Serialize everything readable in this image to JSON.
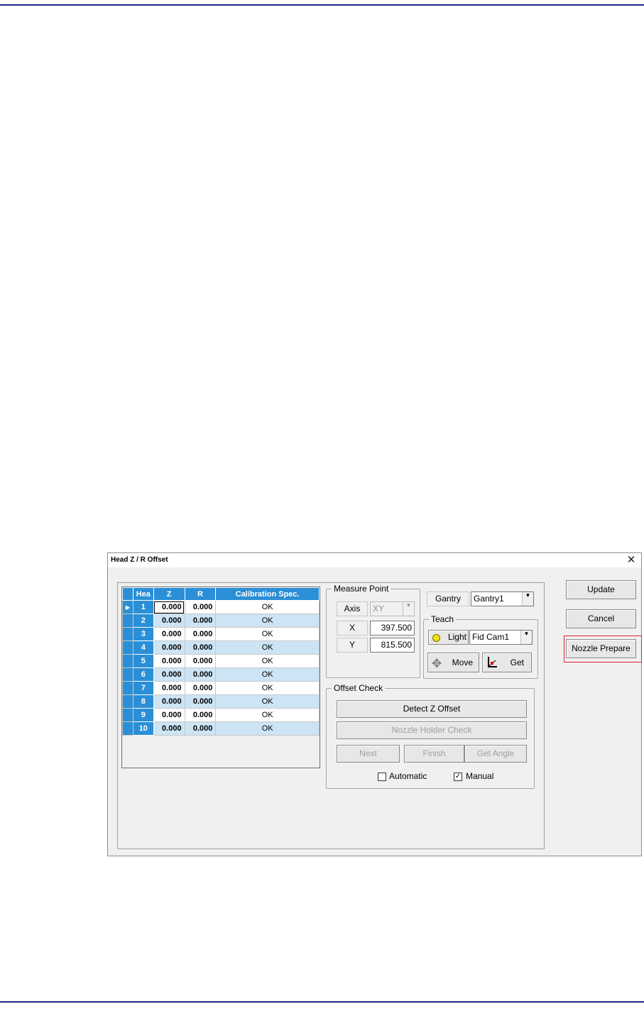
{
  "window": {
    "title": "Head Z / R Offset",
    "close_symbol": "✕"
  },
  "grid": {
    "columns": [
      "Hea",
      "Z",
      "R",
      "Calibration Spec."
    ],
    "row_marker": "▶",
    "rows": [
      {
        "head": "1",
        "z": "0.000",
        "r": "0.000",
        "spec": "OK"
      },
      {
        "head": "2",
        "z": "0.000",
        "r": "0.000",
        "spec": "OK"
      },
      {
        "head": "3",
        "z": "0.000",
        "r": "0.000",
        "spec": "OK"
      },
      {
        "head": "4",
        "z": "0.000",
        "r": "0.000",
        "spec": "OK"
      },
      {
        "head": "5",
        "z": "0.000",
        "r": "0.000",
        "spec": "OK"
      },
      {
        "head": "6",
        "z": "0.000",
        "r": "0.000",
        "spec": "OK"
      },
      {
        "head": "7",
        "z": "0.000",
        "r": "0.000",
        "spec": "OK"
      },
      {
        "head": "8",
        "z": "0.000",
        "r": "0.000",
        "spec": "OK"
      },
      {
        "head": "9",
        "z": "0.000",
        "r": "0.000",
        "spec": "OK"
      },
      {
        "head": "10",
        "z": "0.000",
        "r": "0.000",
        "spec": "OK"
      }
    ]
  },
  "measure_point": {
    "legend": "Measure Point",
    "axis_label": "Axis",
    "axis_value": "XY",
    "x_label": "X",
    "x_value": "397.500",
    "y_label": "Y",
    "y_value": "815.500"
  },
  "gantry": {
    "label": "Gantry",
    "value": "Gantry1"
  },
  "teach": {
    "legend": "Teach",
    "light_label": "Light",
    "camera_value": "Fid Cam1",
    "move_label": "Move",
    "get_label": "Get"
  },
  "offset_check": {
    "legend": "Offset Check",
    "detect_label": "Detect Z Offset",
    "holder_label": "Nozzle Holder Check",
    "next_label": "Next",
    "finish_label": "Finish",
    "angle_label": "Get Angle",
    "automatic_label": "Automatic",
    "automatic_checked": false,
    "manual_label": "Manual",
    "manual_checked": true
  },
  "actions": {
    "update_label": "Update",
    "cancel_label": "Cancel",
    "nozzle_prepare_label": "Nozzle Prepare"
  },
  "colors": {
    "grid_header": "#2a8fd6",
    "alt_row": "#cce4f4",
    "highlight": "#d8232a",
    "page_rule": "#1c2a86"
  }
}
